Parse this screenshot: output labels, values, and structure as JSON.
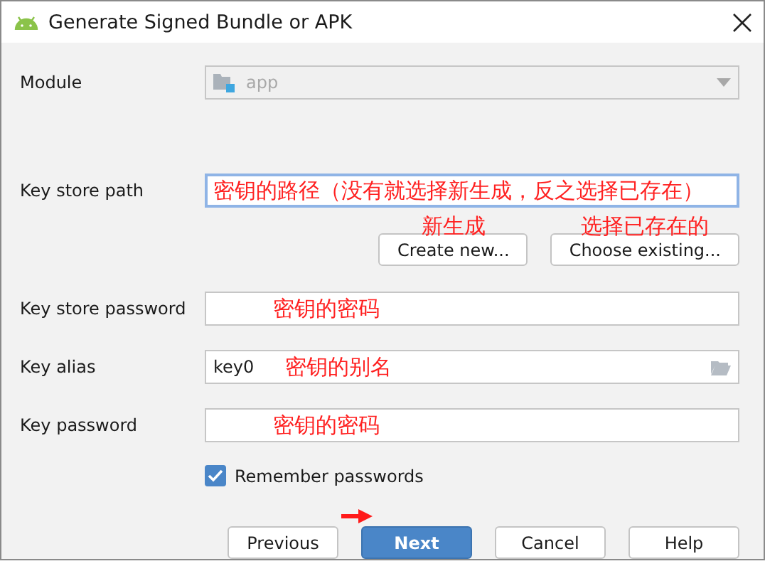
{
  "window": {
    "title": "Generate Signed Bundle or APK"
  },
  "module": {
    "label": "Module",
    "value": "app",
    "disabled": true
  },
  "key_store_path": {
    "label": "Key store path",
    "focused": true,
    "annotation": "密钥的路径（没有就选择新生成，反之选择已存在）"
  },
  "key_store_buttons": [
    {
      "label": "Create new...",
      "annotation": "新生成"
    },
    {
      "label": "Choose existing...",
      "annotation": "选择已存在的"
    }
  ],
  "fields": [
    {
      "kind": "password",
      "label": "Key store password",
      "annotation": "密钥的密码"
    },
    {
      "kind": "alias",
      "label": "Key alias",
      "value": "key0",
      "annotation": "密钥的别名"
    },
    {
      "kind": "password",
      "label": "Key password",
      "annotation": "密钥的密码"
    }
  ],
  "remember": {
    "label": "Remember passwords",
    "checked": true
  },
  "buttons": [
    {
      "label": "Previous",
      "kind": "default"
    },
    {
      "label": "Next",
      "kind": "primary",
      "arrow": true
    },
    {
      "label": "Cancel",
      "kind": "default"
    },
    {
      "label": "Help",
      "kind": "default"
    }
  ]
}
